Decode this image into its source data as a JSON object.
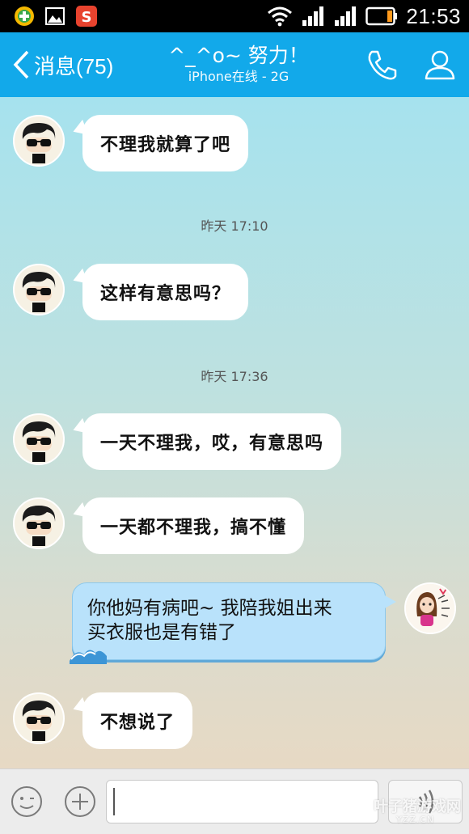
{
  "status_bar": {
    "time": "21:53"
  },
  "header": {
    "back_label": "消息(75)",
    "title": "^_^o~ 努力！",
    "subtitle": "iPhone在线 - 2G"
  },
  "messages": [
    {
      "from": "contact",
      "text": "不理我就算了吧"
    },
    {
      "type": "timestamp",
      "text": "昨天 17:10"
    },
    {
      "from": "contact",
      "text": "这样有意思吗？"
    },
    {
      "type": "timestamp",
      "text": "昨天 17:36"
    },
    {
      "from": "contact",
      "text": "一天不理我，哎，有意思吗"
    },
    {
      "from": "contact",
      "text": "一天都不理我，搞不懂"
    },
    {
      "from": "me",
      "line1": "你他妈有病吧~ 我陪我姐出来",
      "line2": "买衣服也是有错了"
    },
    {
      "from": "contact",
      "text": "不想说了"
    }
  ],
  "input": {
    "value": "",
    "placeholder": ""
  },
  "watermark": {
    "main": "叶子猪游戏网",
    "sub": "YZZ.CN"
  },
  "colors": {
    "header": "#12a9ea",
    "my_bubble": "#b9e2fb",
    "contact_bubble": "#ffffff"
  }
}
